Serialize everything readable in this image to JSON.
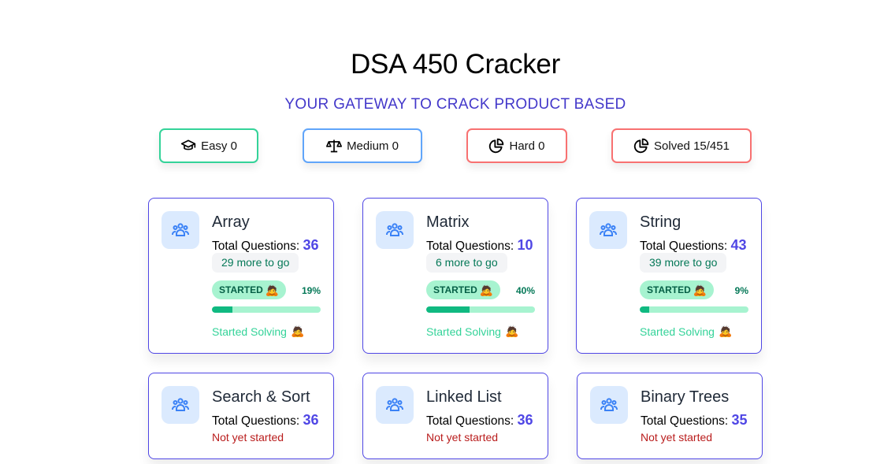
{
  "header": {
    "title": "DSA 450 Cracker",
    "subtitle": "YOUR GATEWAY TO CRACK PRODUCT BASED"
  },
  "stats": {
    "easy": {
      "icon": "graduation-cap-icon",
      "label": "Easy 0"
    },
    "medium": {
      "icon": "scales-icon",
      "label": "Medium 0"
    },
    "hard": {
      "icon": "pie-chart-icon",
      "label": "Hard 0"
    },
    "solved": {
      "icon": "pie-chart-icon",
      "label": "Solved 15/451"
    }
  },
  "colors": {
    "accent": "#4f46e5",
    "easy_border": "#34d399",
    "medium_border": "#60a5fa",
    "hard_border": "#f87171",
    "progress_fill": "#10b981",
    "progress_track": "#a7f3d0",
    "not_started": "#b91c1c"
  },
  "topics": [
    {
      "name": "Array",
      "total_label": "Total Questions:",
      "total": "36",
      "remaining": "29 more to go",
      "status": "STARTED",
      "status_emoji": "🙇",
      "percent_label": "19%",
      "progress": 19,
      "footer": "Started Solving",
      "footer_emoji": "🙇"
    },
    {
      "name": "Matrix",
      "total_label": "Total Questions:",
      "total": "10",
      "remaining": "6 more to go",
      "status": "STARTED",
      "status_emoji": "🙇",
      "percent_label": "40%",
      "progress": 40,
      "footer": "Started Solving",
      "footer_emoji": "🙇"
    },
    {
      "name": "String",
      "total_label": "Total Questions:",
      "total": "43",
      "remaining": "39 more to go",
      "status": "STARTED",
      "status_emoji": "🙇",
      "percent_label": "9%",
      "progress": 9,
      "footer": "Started Solving",
      "footer_emoji": "🙇"
    },
    {
      "name": "Search & Sort",
      "total_label": "Total Questions:",
      "total": "36",
      "footer": "Not yet started"
    },
    {
      "name": "Linked List",
      "total_label": "Total Questions:",
      "total": "36",
      "footer": "Not yet started"
    },
    {
      "name": "Binary Trees",
      "total_label": "Total Questions:",
      "total": "35",
      "footer": "Not yet started"
    }
  ]
}
